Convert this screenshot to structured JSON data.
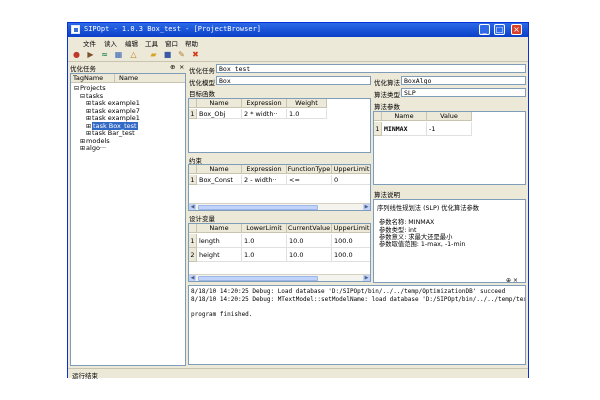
{
  "window": {
    "title": "SIPOpt - 1.0.3  Box_test - [ProjectBrowser]",
    "minimize": "_",
    "maximize": "□",
    "close": "×"
  },
  "menu": [
    "文件",
    "读入",
    "编辑",
    "工具",
    "窗口",
    "帮助"
  ],
  "toolbar": [
    {
      "icon": "stop-icon",
      "glyph": "●",
      "color": "#c0392b"
    },
    {
      "icon": "run-icon",
      "glyph": "▶",
      "color": "#7a5230"
    },
    {
      "icon": "chart-icon",
      "glyph": "≈",
      "color": "#2e8b57"
    },
    {
      "icon": "table-icon",
      "glyph": "▦",
      "color": "#3a66b7"
    },
    {
      "icon": "triangle-icon",
      "glyph": "△",
      "color": "#c27a1a"
    },
    {
      "icon": "open-folder-icon",
      "glyph": "▰",
      "color": "#d6a323"
    },
    {
      "icon": "save-icon",
      "glyph": "■",
      "color": "#3b59a7"
    },
    {
      "icon": "edit-icon",
      "glyph": "✎",
      "color": "#b07a2a"
    },
    {
      "icon": "delete-icon",
      "glyph": "✖",
      "color": "#d03c1f"
    }
  ],
  "left_panel": {
    "title": "优化任务",
    "pin": "⊕",
    "close": "×",
    "columns": [
      "TagName",
      "Name"
    ],
    "tree": [
      {
        "indent": 0,
        "expander": "⊟",
        "label": "Projects",
        "selected": false
      },
      {
        "indent": 1,
        "expander": "⊟",
        "label": "tasks",
        "selected": false
      },
      {
        "indent": 2,
        "expander": "⊞",
        "label": "task example1",
        "selected": false
      },
      {
        "indent": 2,
        "expander": "⊞",
        "label": "task example7",
        "selected": false
      },
      {
        "indent": 2,
        "expander": "⊞",
        "label": "task example1",
        "selected": false
      },
      {
        "indent": 2,
        "expander": "⊞",
        "label": "task Box_test",
        "selected": true
      },
      {
        "indent": 2,
        "expander": "⊞",
        "label": "task Bar_test",
        "selected": false
      },
      {
        "indent": 1,
        "expander": "⊞",
        "label": "models",
        "selected": false
      },
      {
        "indent": 1,
        "expander": "⊞",
        "label": "algo···",
        "selected": false
      }
    ]
  },
  "task": {
    "label": "优化任务",
    "value": "Box_test"
  },
  "model": {
    "label": "优化模型",
    "value": "Box"
  },
  "objective": {
    "title": "目标函数",
    "columns": [
      "Name",
      "Expression",
      "Weight"
    ],
    "rows": [
      {
        "n": "1",
        "cells": [
          "Box_Obj",
          "2 * width··",
          "1.0"
        ]
      }
    ]
  },
  "constraints": {
    "title": "约束",
    "columns": [
      "Name",
      "Expression",
      "FunctionType",
      "UpperLimit"
    ],
    "rows": [
      {
        "n": "1",
        "cells": [
          "Box_Const",
          "2 - width··",
          "<=",
          "0"
        ]
      }
    ]
  },
  "design_vars": {
    "title": "设计变量",
    "columns": [
      "Name",
      "LowerLimit",
      "CurrentValue",
      "UpperLimit"
    ],
    "rows": [
      {
        "n": "1",
        "cells": [
          "length",
          "1.0",
          "10.0",
          "100.0"
        ]
      },
      {
        "n": "2",
        "cells": [
          "height",
          "1.0",
          "10.0",
          "100.0"
        ]
      }
    ]
  },
  "algorithm": {
    "label": "优化算法",
    "value": "BoxAlgo",
    "type_label": "算法类型",
    "type_value": "SLP"
  },
  "algo_params": {
    "title": "算法参数",
    "columns": [
      "Name",
      "Value"
    ],
    "rows": [
      {
        "n": "1",
        "cells": [
          "MINMAX",
          "-1"
        ]
      }
    ]
  },
  "algo_desc": {
    "title": "算法说明",
    "lines": [
      "序列线性规划法 (SLP) 优化算法参数",
      "",
      "参数名称:  MINMAX",
      "参数类型:  int",
      "参数意义:  求最大还是最小",
      "参数取值范围: 1-max, -1-min"
    ]
  },
  "log": {
    "lines": [
      "8/18/10 14:20:25 Debug: Load database  'D:/SIPOpt/bin/../../temp/OptimizationDB'  succeed",
      "8/18/10 14:20:25 Debug: MTextModel::setModelName: load database  'D:/SIPOpt/bin/../../temp/textD",
      "",
      "program finished."
    ]
  },
  "status": {
    "text": "运行结束"
  }
}
